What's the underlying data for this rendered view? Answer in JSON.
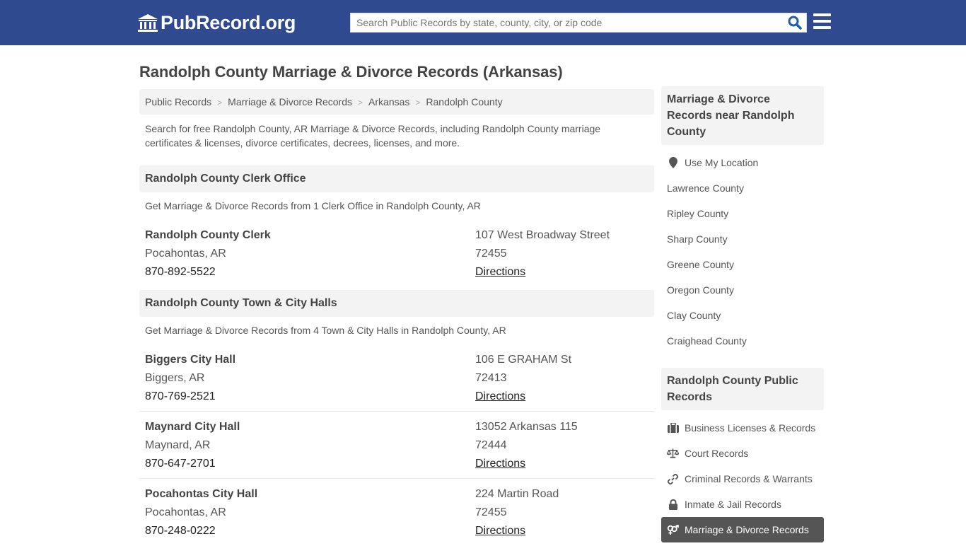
{
  "header": {
    "logo_text": "PubRecord.org",
    "search_placeholder": "Search Public Records by state, county, city, or zip code"
  },
  "page": {
    "title": "Randolph County Marriage & Divorce Records (Arkansas)",
    "breadcrumb": [
      "Public Records",
      "Marriage & Divorce Records",
      "Arkansas",
      "Randolph County"
    ],
    "intro": "Search for free Randolph County, AR Marriage & Divorce Records, including Randolph County marriage certificates & licenses, divorce certificates, decrees, licenses, and more."
  },
  "sections": [
    {
      "heading": "Randolph County Clerk Office",
      "subtitle": "Get Marriage & Divorce Records from 1 Clerk Office in Randolph County, AR",
      "entries": [
        {
          "name": "Randolph County Clerk",
          "city": "Pocahontas, AR",
          "phone": "870-892-5522",
          "address": "107 West Broadway Street",
          "zip": "72455",
          "link": "Directions"
        }
      ]
    },
    {
      "heading": "Randolph County Town & City Halls",
      "subtitle": "Get Marriage & Divorce Records from 4 Town & City Halls in Randolph County, AR",
      "entries": [
        {
          "name": "Biggers City Hall",
          "city": "Biggers, AR",
          "phone": "870-769-2521",
          "address": "106 E GRAHAM St",
          "zip": "72413",
          "link": "Directions"
        },
        {
          "name": "Maynard City Hall",
          "city": "Maynard, AR",
          "phone": "870-647-2701",
          "address": "13052 Arkansas 115",
          "zip": "72444",
          "link": "Directions"
        },
        {
          "name": "Pocahontas City Hall",
          "city": "Pocahontas, AR",
          "phone": "870-248-0222",
          "address": "224 Martin Road",
          "zip": "72455",
          "link": "Directions"
        }
      ]
    }
  ],
  "sidebar": {
    "nearby_heading": "Marriage & Divorce Records near Randolph County",
    "use_location": "Use My Location",
    "nearby": [
      "Lawrence County",
      "Ripley County",
      "Sharp County",
      "Greene County",
      "Oregon County",
      "Clay County",
      "Craighead County"
    ],
    "public_heading": "Randolph County Public Records",
    "public_records": [
      {
        "label": "Business Licenses & Records",
        "icon": "briefcase-icon"
      },
      {
        "label": "Court Records",
        "icon": "scale-icon"
      },
      {
        "label": "Criminal Records & Warrants",
        "icon": "link-icon"
      },
      {
        "label": "Inmate & Jail Records",
        "icon": "lock-icon"
      },
      {
        "label": "Marriage & Divorce Records",
        "icon": "gender-icon",
        "active": true
      }
    ]
  },
  "colors": {
    "header_bg": "#2f4a8e",
    "search_icon": "#1f5ea8",
    "active_item_bg": "#555555"
  }
}
